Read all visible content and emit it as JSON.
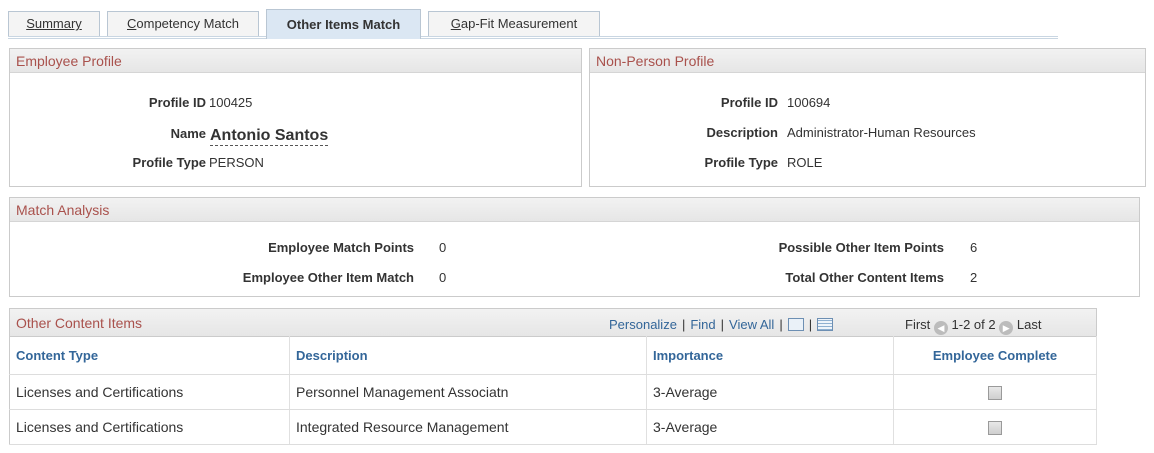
{
  "tabs": [
    {
      "label": "Summary",
      "accel": "S",
      "rest": "ummary",
      "active": false
    },
    {
      "label": "Competency Match",
      "accel": "C",
      "rest": "ompetency Match",
      "active": false
    },
    {
      "label": "Other Items Match",
      "active": true
    },
    {
      "label": "Gap-Fit Measurement",
      "accel": "G",
      "rest": "ap-Fit Measurement",
      "active": false
    }
  ],
  "employee_profile": {
    "title": "Employee Profile",
    "profile_id_label": "Profile ID",
    "profile_id": "100425",
    "name_label": "Name",
    "name": "Antonio Santos",
    "profile_type_label": "Profile Type",
    "profile_type": "PERSON"
  },
  "non_person_profile": {
    "title": "Non-Person Profile",
    "profile_id_label": "Profile ID",
    "profile_id": "100694",
    "description_label": "Description",
    "description": "Administrator-Human Resources",
    "profile_type_label": "Profile Type",
    "profile_type": "ROLE"
  },
  "match_analysis": {
    "title": "Match Analysis",
    "employee_match_points_label": "Employee Match Points",
    "employee_match_points": "0",
    "employee_other_item_match_label": "Employee Other Item Match",
    "employee_other_item_match": "0",
    "possible_other_item_points_label": "Possible Other Item Points",
    "possible_other_item_points": "6",
    "total_other_content_items_label": "Total Other Content Items",
    "total_other_content_items": "2"
  },
  "grid": {
    "title": "Other Content Items",
    "personalize": "Personalize",
    "find": "Find",
    "view_all": "View All",
    "first": "First",
    "range": "1-2 of 2",
    "last": "Last",
    "columns": [
      "Content Type",
      "Description",
      "Importance",
      "Employee Complete"
    ],
    "rows": [
      {
        "content_type": "Licenses and Certifications",
        "description": "Personnel Management Associatn",
        "importance": "3-Average",
        "complete": false
      },
      {
        "content_type": "Licenses and Certifications",
        "description": "Integrated Resource Management",
        "importance": "3-Average",
        "complete": false
      }
    ]
  },
  "colors": {
    "section_title": "#a9514c",
    "link": "#336699",
    "active_tab": "#dbe7f3"
  }
}
